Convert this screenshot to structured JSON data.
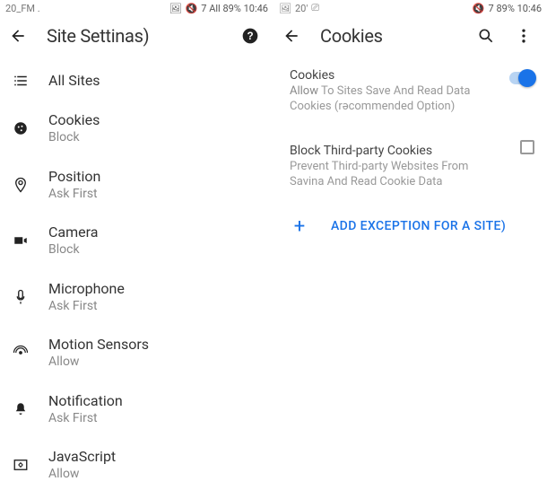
{
  "left": {
    "status": {
      "left": "20_FM .",
      "right": "7 All 89% 10:46"
    },
    "header": {
      "title": "Site Settinas)"
    },
    "items": [
      {
        "label": "All Sites",
        "sub": "",
        "icon": "list-icon"
      },
      {
        "label": "Cookies",
        "sub": "Block",
        "icon": "cookie-icon"
      },
      {
        "label": "Position",
        "sub": "Ask First",
        "icon": "pin-icon"
      },
      {
        "label": "Camera",
        "sub": "Block",
        "icon": "camera-icon"
      },
      {
        "label": "Microphone",
        "sub": "Ask First",
        "icon": "mic-icon"
      },
      {
        "label": "Motion Sensors",
        "sub": "Allow",
        "icon": "sensor-icon"
      },
      {
        "label": "Notification",
        "sub": "Ask First",
        "icon": "bell-icon"
      },
      {
        "label": "JavaScript",
        "sub": "Allow",
        "icon": "js-icon"
      }
    ]
  },
  "right": {
    "status": {
      "left": "20'",
      "right": "7 89% 10:46"
    },
    "header": {
      "title": "Cookies"
    },
    "section1": {
      "title": "Cookies",
      "sub_lead": "Allow",
      "sub_rest": " To Sites Save And Read Data Cookies (rəcommended Option)"
    },
    "section2": {
      "title": "Block Third-party Cookies",
      "sub": "Prevent Third-party Websites From Savina And Read Cookie Data"
    },
    "add": {
      "plus": "+",
      "label": "ADD EXCEPTION FOR A SITE)"
    }
  }
}
